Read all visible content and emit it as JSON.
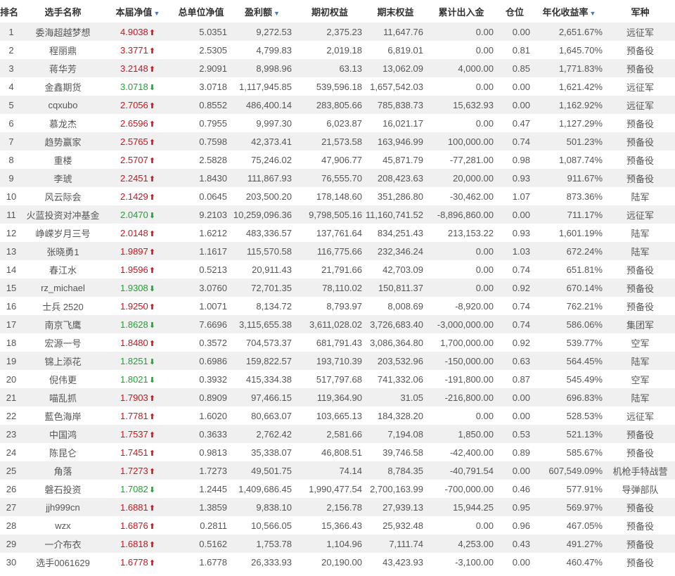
{
  "headers": {
    "rank": "排名",
    "name": "选手名称",
    "net": "本届净值",
    "total_net": "总单位净值",
    "profit": "盈利额",
    "begin_equity": "期初权益",
    "end_equity": "期末权益",
    "flow": "累计出入金",
    "position": "仓位",
    "annual": "年化收益率",
    "army": "军种"
  },
  "sort_icon": "▼",
  "colors": {
    "up": "#c8151d",
    "down": "#1aa52e",
    "sort": "#3a7bd5"
  },
  "rows": [
    {
      "rank": "1",
      "name": "委海超越梦想",
      "net": "4.9038",
      "dir": "up",
      "total_net": "5.0351",
      "profit": "9,272.53",
      "begin": "2,375.23",
      "end": "11,647.76",
      "flow": "0.00",
      "pos": "0.00",
      "annual": "2,651.67%",
      "army": "远征军"
    },
    {
      "rank": "2",
      "name": "程丽鼎",
      "net": "3.3771",
      "dir": "up",
      "total_net": "2.5305",
      "profit": "4,799.83",
      "begin": "2,019.18",
      "end": "6,819.01",
      "flow": "0.00",
      "pos": "0.81",
      "annual": "1,645.70%",
      "army": "预备役"
    },
    {
      "rank": "3",
      "name": "蒋华芳",
      "net": "3.2148",
      "dir": "up",
      "total_net": "2.9091",
      "profit": "8,998.96",
      "begin": "63.13",
      "end": "13,062.09",
      "flow": "4,000.00",
      "pos": "0.85",
      "annual": "1,771.83%",
      "army": "预备役"
    },
    {
      "rank": "4",
      "name": "金鑫期货",
      "net": "3.0718",
      "dir": "down",
      "total_net": "3.0718",
      "profit": "1,117,945.85",
      "begin": "539,596.18",
      "end": "1,657,542.03",
      "flow": "0.00",
      "pos": "0.00",
      "annual": "1,621.42%",
      "army": "远征军"
    },
    {
      "rank": "5",
      "name": "cqxubo",
      "net": "2.7056",
      "dir": "up",
      "total_net": "0.8552",
      "profit": "486,400.14",
      "begin": "283,805.66",
      "end": "785,838.73",
      "flow": "15,632.93",
      "pos": "0.00",
      "annual": "1,162.92%",
      "army": "远征军"
    },
    {
      "rank": "6",
      "name": "慕龙杰",
      "net": "2.6596",
      "dir": "up",
      "total_net": "0.7955",
      "profit": "9,997.30",
      "begin": "6,023.87",
      "end": "16,021.17",
      "flow": "0.00",
      "pos": "0.47",
      "annual": "1,127.29%",
      "army": "预备役"
    },
    {
      "rank": "7",
      "name": "趋势赢家",
      "net": "2.5765",
      "dir": "up",
      "total_net": "0.7598",
      "profit": "42,373.41",
      "begin": "21,573.58",
      "end": "163,946.99",
      "flow": "100,000.00",
      "pos": "0.74",
      "annual": "501.23%",
      "army": "预备役"
    },
    {
      "rank": "8",
      "name": "重楼",
      "net": "2.5707",
      "dir": "up",
      "total_net": "2.5828",
      "profit": "75,246.02",
      "begin": "47,906.77",
      "end": "45,871.79",
      "flow": "-77,281.00",
      "pos": "0.98",
      "annual": "1,087.74%",
      "army": "预备役"
    },
    {
      "rank": "9",
      "name": "李琥",
      "net": "2.2451",
      "dir": "up",
      "total_net": "1.8430",
      "profit": "111,867.93",
      "begin": "76,555.70",
      "end": "208,423.63",
      "flow": "20,000.00",
      "pos": "0.93",
      "annual": "911.67%",
      "army": "预备役"
    },
    {
      "rank": "10",
      "name": "风云际会",
      "net": "2.1429",
      "dir": "up",
      "total_net": "0.0645",
      "profit": "203,500.20",
      "begin": "178,148.60",
      "end": "351,286.80",
      "flow": "-30,462.00",
      "pos": "1.07",
      "annual": "873.36%",
      "army": "陆军"
    },
    {
      "rank": "11",
      "name": "火蓝投资对冲基金",
      "net": "2.0470",
      "dir": "down",
      "total_net": "9.2103",
      "profit": "10,259,096.36",
      "begin": "9,798,505.16",
      "end": "11,160,741.52",
      "flow": "-8,896,860.00",
      "pos": "0.00",
      "annual": "711.17%",
      "army": "远征军"
    },
    {
      "rank": "12",
      "name": "峥嵘岁月三号",
      "net": "2.0148",
      "dir": "up",
      "total_net": "1.6212",
      "profit": "483,336.57",
      "begin": "137,761.64",
      "end": "834,251.43",
      "flow": "213,153.22",
      "pos": "0.93",
      "annual": "1,601.19%",
      "army": "陆军"
    },
    {
      "rank": "13",
      "name": "张晓勇1",
      "net": "1.9897",
      "dir": "up",
      "total_net": "1.1617",
      "profit": "115,570.58",
      "begin": "116,775.66",
      "end": "232,346.24",
      "flow": "0.00",
      "pos": "1.03",
      "annual": "672.24%",
      "army": "陆军"
    },
    {
      "rank": "14",
      "name": "春江水",
      "net": "1.9596",
      "dir": "up",
      "total_net": "0.5213",
      "profit": "20,911.43",
      "begin": "21,791.66",
      "end": "42,703.09",
      "flow": "0.00",
      "pos": "0.74",
      "annual": "651.81%",
      "army": "预备役"
    },
    {
      "rank": "15",
      "name": "rz_michael",
      "net": "1.9308",
      "dir": "down",
      "total_net": "3.0760",
      "profit": "72,701.35",
      "begin": "78,110.02",
      "end": "150,811.37",
      "flow": "0.00",
      "pos": "0.92",
      "annual": "670.14%",
      "army": "预备役"
    },
    {
      "rank": "16",
      "name": "士兵 2520",
      "net": "1.9250",
      "dir": "up",
      "total_net": "1.0071",
      "profit": "8,134.72",
      "begin": "8,793.97",
      "end": "8,008.69",
      "flow": "-8,920.00",
      "pos": "0.74",
      "annual": "762.21%",
      "army": "预备役"
    },
    {
      "rank": "17",
      "name": "南京飞鹰",
      "net": "1.8628",
      "dir": "down",
      "total_net": "7.6696",
      "profit": "3,115,655.38",
      "begin": "3,611,028.02",
      "end": "3,726,683.40",
      "flow": "-3,000,000.00",
      "pos": "0.74",
      "annual": "586.06%",
      "army": "集团军"
    },
    {
      "rank": "18",
      "name": "宏源一号",
      "net": "1.8480",
      "dir": "up",
      "total_net": "0.3572",
      "profit": "704,573.37",
      "begin": "681,791.43",
      "end": "3,086,364.80",
      "flow": "1,700,000.00",
      "pos": "0.92",
      "annual": "539.77%",
      "army": "空军"
    },
    {
      "rank": "19",
      "name": "锦上添花",
      "net": "1.8251",
      "dir": "down",
      "total_net": "0.6986",
      "profit": "159,822.57",
      "begin": "193,710.39",
      "end": "203,532.96",
      "flow": "-150,000.00",
      "pos": "0.63",
      "annual": "564.45%",
      "army": "陆军"
    },
    {
      "rank": "20",
      "name": "倪伟更",
      "net": "1.8021",
      "dir": "down",
      "total_net": "0.3932",
      "profit": "415,334.38",
      "begin": "517,797.68",
      "end": "741,332.06",
      "flow": "-191,800.00",
      "pos": "0.87",
      "annual": "545.49%",
      "army": "空军"
    },
    {
      "rank": "21",
      "name": "喵乱抓",
      "net": "1.7903",
      "dir": "up",
      "total_net": "0.8909",
      "profit": "97,466.15",
      "begin": "119,364.90",
      "end": "31.05",
      "flow": "-216,800.00",
      "pos": "0.00",
      "annual": "696.83%",
      "army": "陆军"
    },
    {
      "rank": "22",
      "name": "藍色海岸",
      "net": "1.7781",
      "dir": "up",
      "total_net": "1.6020",
      "profit": "80,663.07",
      "begin": "103,665.13",
      "end": "184,328.20",
      "flow": "0.00",
      "pos": "0.00",
      "annual": "528.53%",
      "army": "远征军"
    },
    {
      "rank": "23",
      "name": "中国鸿",
      "net": "1.7537",
      "dir": "up",
      "total_net": "0.3633",
      "profit": "2,762.42",
      "begin": "2,581.66",
      "end": "7,194.08",
      "flow": "1,850.00",
      "pos": "0.53",
      "annual": "521.13%",
      "army": "预备役"
    },
    {
      "rank": "24",
      "name": "陈昆仑",
      "net": "1.7451",
      "dir": "up",
      "total_net": "0.9813",
      "profit": "35,338.07",
      "begin": "46,808.51",
      "end": "39,746.58",
      "flow": "-42,400.00",
      "pos": "0.89",
      "annual": "585.67%",
      "army": "预备役"
    },
    {
      "rank": "25",
      "name": "角落",
      "net": "1.7273",
      "dir": "up",
      "total_net": "1.7273",
      "profit": "49,501.75",
      "begin": "74.14",
      "end": "8,784.35",
      "flow": "-40,791.54",
      "pos": "0.00",
      "annual": "607,549.09%",
      "army": "机枪手特战营"
    },
    {
      "rank": "26",
      "name": "磐石投资",
      "net": "1.7082",
      "dir": "down",
      "total_net": "1.2445",
      "profit": "1,409,686.45",
      "begin": "1,990,477.54",
      "end": "2,700,163.99",
      "flow": "-700,000.00",
      "pos": "0.46",
      "annual": "577.91%",
      "army": "导弹部队"
    },
    {
      "rank": "27",
      "name": "jjh999cn",
      "net": "1.6881",
      "dir": "up",
      "total_net": "1.3859",
      "profit": "9,838.10",
      "begin": "2,156.78",
      "end": "27,939.13",
      "flow": "15,944.25",
      "pos": "0.95",
      "annual": "569.97%",
      "army": "预备役"
    },
    {
      "rank": "28",
      "name": "wzx",
      "net": "1.6876",
      "dir": "up",
      "total_net": "0.2811",
      "profit": "10,566.05",
      "begin": "15,366.43",
      "end": "25,932.48",
      "flow": "0.00",
      "pos": "0.96",
      "annual": "467.05%",
      "army": "预备役"
    },
    {
      "rank": "29",
      "name": "一介布衣",
      "net": "1.6818",
      "dir": "up",
      "total_net": "0.5162",
      "profit": "1,753.78",
      "begin": "1,104.96",
      "end": "7,111.74",
      "flow": "4,253.00",
      "pos": "0.43",
      "annual": "491.27%",
      "army": "预备役"
    },
    {
      "rank": "30",
      "name": "选手0061629",
      "net": "1.6778",
      "dir": "up",
      "total_net": "1.6778",
      "profit": "26,333.93",
      "begin": "20,190.00",
      "end": "43,423.93",
      "flow": "-3,100.00",
      "pos": "0.00",
      "annual": "460.47%",
      "army": "预备役"
    }
  ]
}
